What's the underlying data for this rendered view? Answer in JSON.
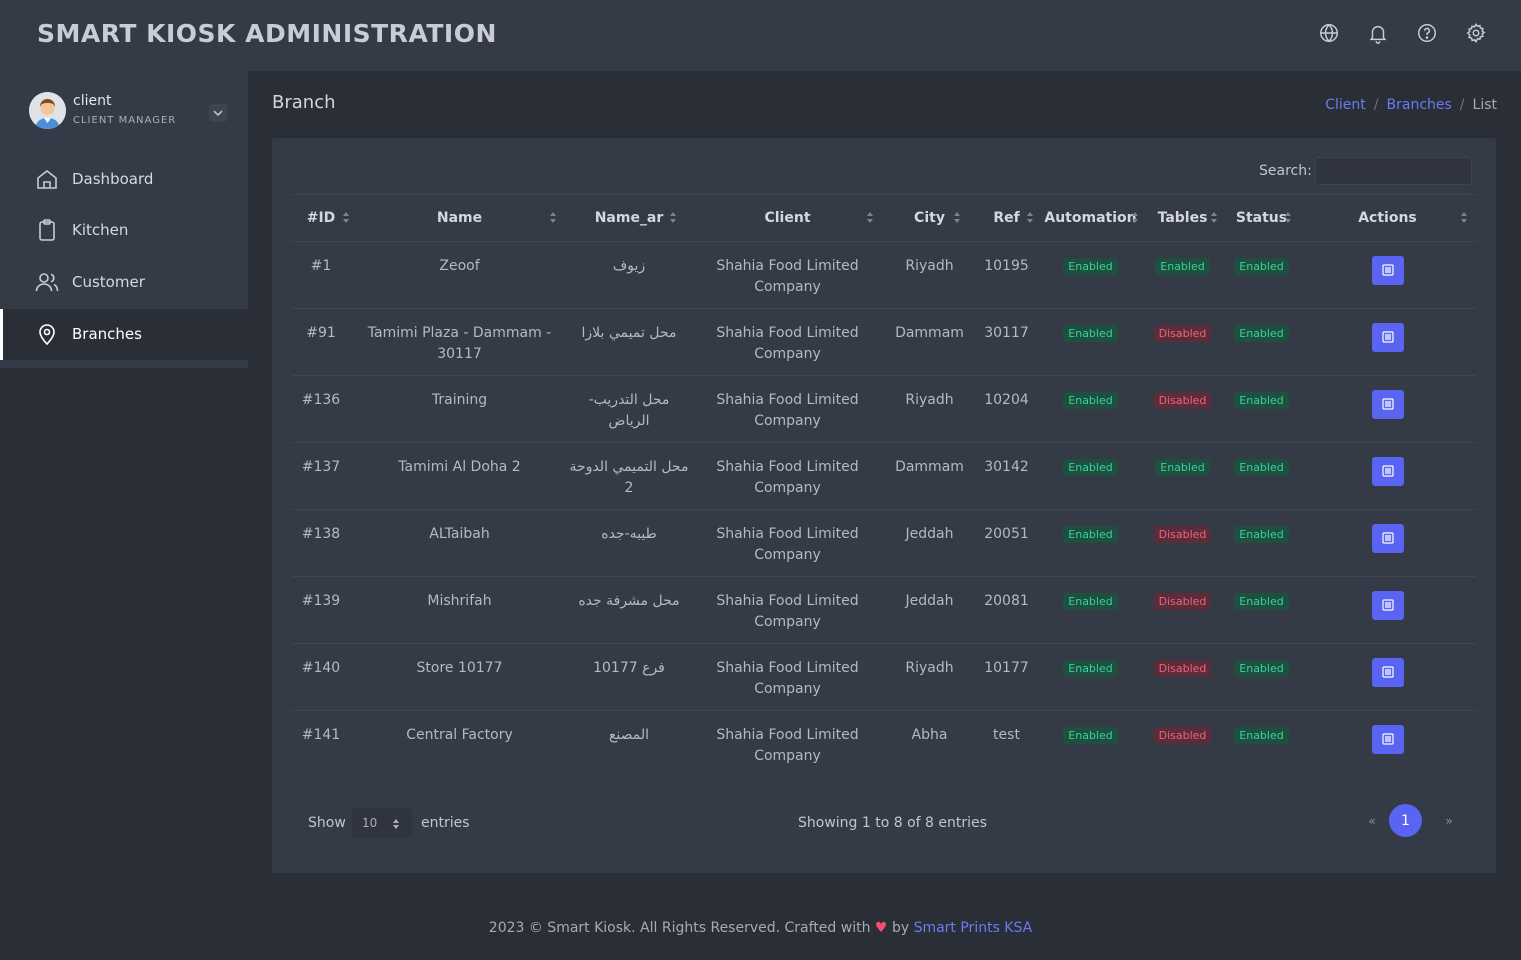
{
  "app": {
    "title": "SMART KIOSK ADMINISTRATION"
  },
  "topbar_icons": [
    "globe-icon",
    "bell-icon",
    "help-icon",
    "settings-icon"
  ],
  "profile": {
    "name": "client",
    "role": "CLIENT MANAGER"
  },
  "sidebar": {
    "items": [
      {
        "label": "Dashboard",
        "icon": "home-icon"
      },
      {
        "label": "Kitchen",
        "icon": "clipboard-icon"
      },
      {
        "label": "Customer",
        "icon": "users-icon"
      },
      {
        "label": "Branches",
        "icon": "map-pin-icon",
        "active": true
      }
    ]
  },
  "page": {
    "title": "Branch"
  },
  "breadcrumb": {
    "items": [
      "Client",
      "Branches",
      "List"
    ],
    "separator": "/"
  },
  "search": {
    "label": "Search:",
    "value": ""
  },
  "table": {
    "columns": [
      "#ID",
      "Name",
      "Name_ar",
      "Client",
      "City",
      "Ref",
      "Automation",
      "Tables",
      "Status",
      "Actions"
    ],
    "rows": [
      {
        "id": "#1",
        "name": "Zeoof",
        "name_ar": "زيوف",
        "client": "Shahia Food Limited Company",
        "city": "Riyadh",
        "ref": "10195",
        "automation": "Enabled",
        "tables": "Enabled",
        "status": "Enabled"
      },
      {
        "id": "#91",
        "name": "Tamimi Plaza - Dammam - 30117",
        "name_ar": "محل تميمي بلازا",
        "client": "Shahia Food Limited Company",
        "city": "Dammam",
        "ref": "30117",
        "automation": "Enabled",
        "tables": "Disabled",
        "status": "Enabled"
      },
      {
        "id": "#136",
        "name": "Training",
        "name_ar": "محل التدريب- الرياض",
        "client": "Shahia Food Limited Company",
        "city": "Riyadh",
        "ref": "10204",
        "automation": "Enabled",
        "tables": "Disabled",
        "status": "Enabled"
      },
      {
        "id": "#137",
        "name": "Tamimi Al Doha 2",
        "name_ar": "محل التميمي الدوحة 2",
        "client": "Shahia Food Limited Company",
        "city": "Dammam",
        "ref": "30142",
        "automation": "Enabled",
        "tables": "Enabled",
        "status": "Enabled"
      },
      {
        "id": "#138",
        "name": "ALTaibah",
        "name_ar": "طيبه-جده",
        "client": "Shahia Food Limited Company",
        "city": "Jeddah",
        "ref": "20051",
        "automation": "Enabled",
        "tables": "Disabled",
        "status": "Enabled"
      },
      {
        "id": "#139",
        "name": "Mishrifah",
        "name_ar": "محل مشرفة جده",
        "client": "Shahia Food Limited Company",
        "city": "Jeddah",
        "ref": "20081",
        "automation": "Enabled",
        "tables": "Disabled",
        "status": "Enabled"
      },
      {
        "id": "#140",
        "name": "Store 10177",
        "name_ar": "فرع 10177",
        "client": "Shahia Food Limited Company",
        "city": "Riyadh",
        "ref": "10177",
        "automation": "Enabled",
        "tables": "Disabled",
        "status": "Enabled"
      },
      {
        "id": "#141",
        "name": "Central Factory",
        "name_ar": "المصنع",
        "client": "Shahia Food Limited Company",
        "city": "Abha",
        "ref": "test",
        "automation": "Enabled",
        "tables": "Disabled",
        "status": "Enabled"
      }
    ]
  },
  "pagination": {
    "show_label": "Show",
    "page_size": "10",
    "entries_label": "entries",
    "info": "Showing 1 to 8 of 8 entries",
    "prev": "«",
    "current_page": "1",
    "next": "»"
  },
  "footer": {
    "text": "2023 © Smart Kiosk. All Rights Reserved. Crafted with",
    "heart": "♥",
    "by": "by",
    "brand": "Smart Prints KSA"
  },
  "colors": {
    "accent": "#5965f2",
    "link": "#6c7bf0",
    "enabled": "#36d39a",
    "disabled": "#f06080",
    "panel": "#343a46",
    "background": "#2a2e37"
  }
}
